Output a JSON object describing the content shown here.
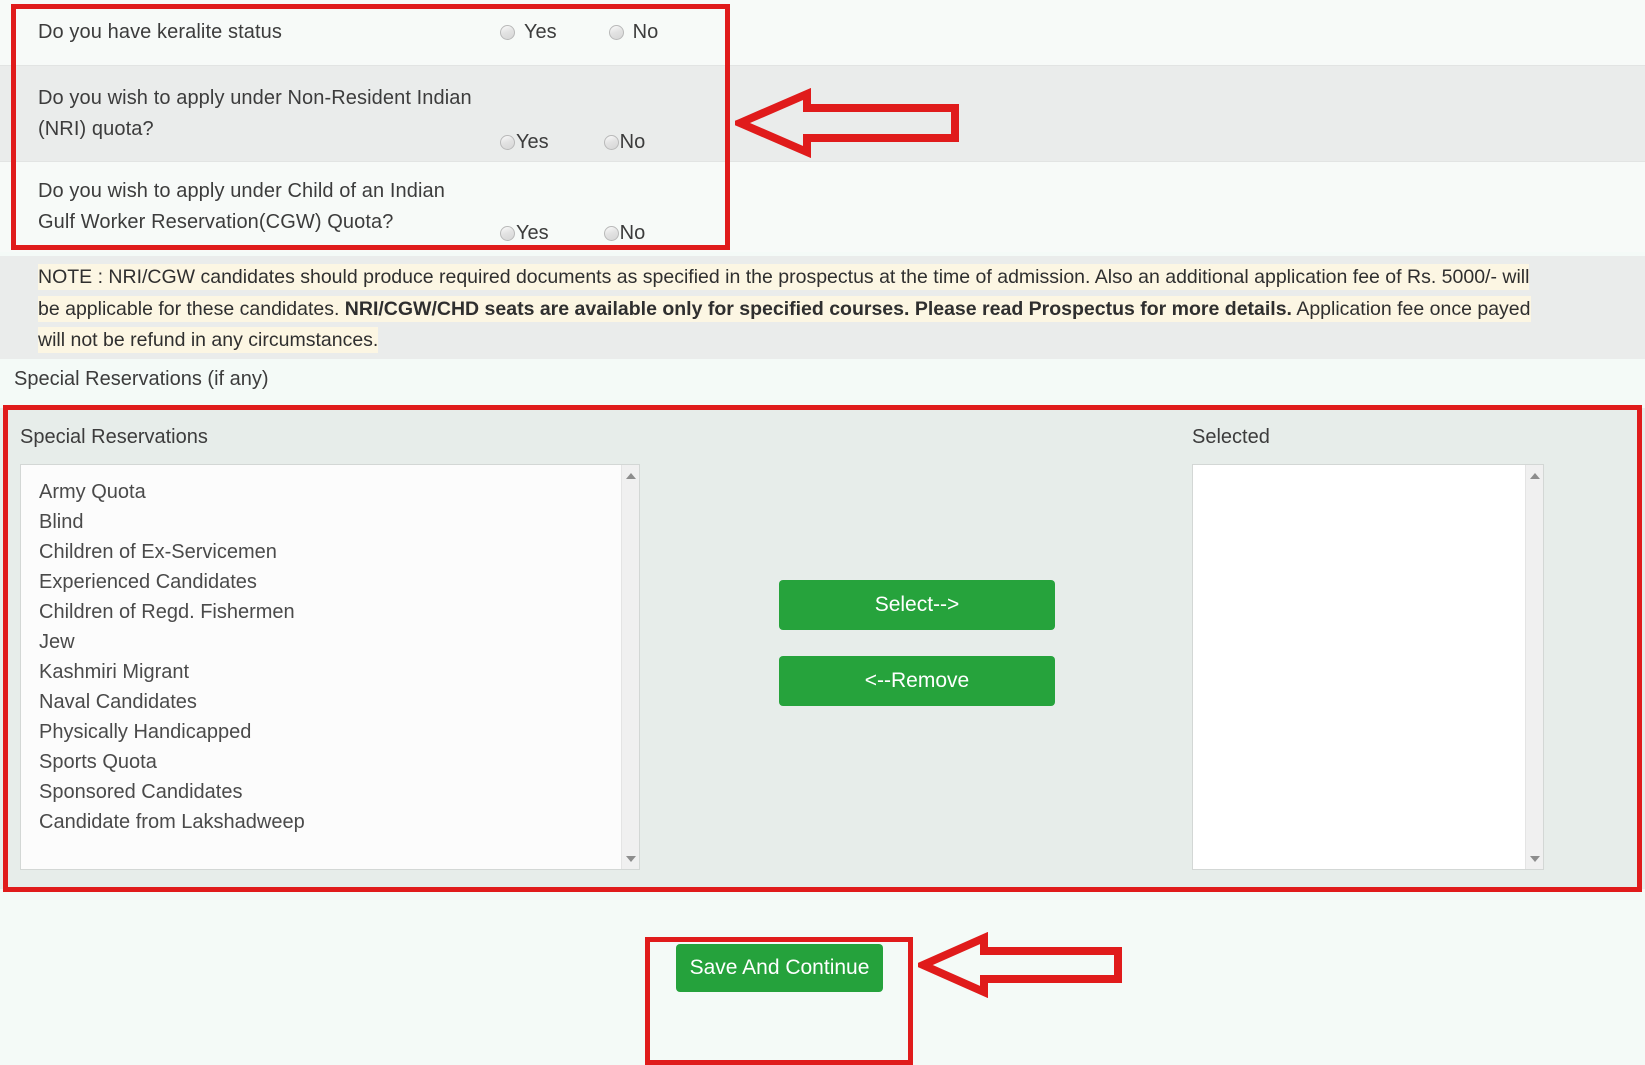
{
  "quota_questions": [
    {
      "label": "Do you have keralite status",
      "yes": "Yes",
      "no": "No"
    },
    {
      "label_line1": "Do you wish to apply under Non-Resident Indian",
      "label_line2": "(NRI) quota?",
      "yes": "Yes",
      "no": "No"
    },
    {
      "label_line1": "Do you wish to apply under Child of an Indian",
      "label_line2": "Gulf Worker Reservation(CGW) Quota?",
      "yes": "Yes",
      "no": "No"
    }
  ],
  "note": {
    "prefix": "NOTE : NRI/CGW candidates should produce required documents as specified in the prospectus at the time of admission. Also an additional application fee of Rs. 5000/- will be applicable for these candidates. ",
    "bold": "NRI/CGW/CHD seats are available only for specified courses. Please read Prospectus for more details.",
    "suffix": " Application fee once payed will not be refund in any circumstances."
  },
  "special_reservations": {
    "caption": "Special Reservations (if any)",
    "available_heading": "Special Reservations",
    "selected_heading": "Selected",
    "available_options": [
      "Army Quota",
      "Blind",
      "Children of Ex-Servicemen",
      "Experienced Candidates",
      "Children of Regd. Fishermen",
      "Jew",
      "Kashmiri Migrant",
      "Naval Candidates",
      "Physically Handicapped",
      "Sports Quota",
      "Sponsored Candidates",
      "Candidate from Lakshadweep"
    ],
    "selected_options": [],
    "select_button": "Select-->",
    "remove_button": "<--Remove"
  },
  "footer": {
    "save_button": "Save And Continue"
  },
  "colors": {
    "annotation_red": "#e01b1b",
    "button_green": "#26a33c",
    "note_highlight": "#fcf6e3",
    "panel_background": "#e7edea"
  }
}
